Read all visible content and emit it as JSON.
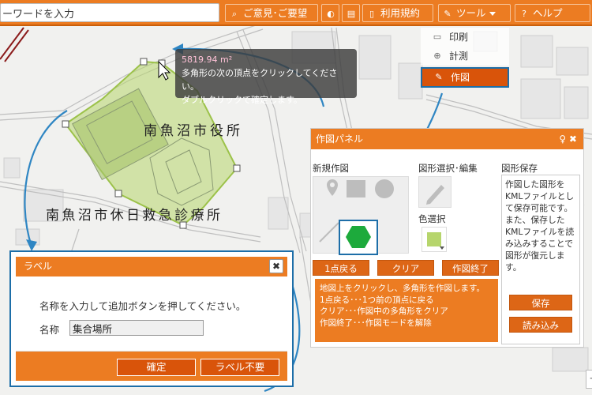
{
  "header": {
    "search_value": "ーワードを入力",
    "search_icon_glyph": "⌕",
    "feedback_label": "ご意見･ご要望",
    "tip_icon_glyph": "◐",
    "chat_icon_glyph": "▤",
    "terms_icon_glyph": "▯",
    "terms_label": "利用規約",
    "tools_icon_glyph": "✎",
    "tools_label": "ツール",
    "help_icon_glyph": "?",
    "help_label": "ヘルプ"
  },
  "tools_menu": {
    "items": [
      {
        "icon": "▭",
        "label": "印刷"
      },
      {
        "icon": "⊕",
        "label": "計測"
      },
      {
        "icon": "✎",
        "label": "作図"
      }
    ]
  },
  "map": {
    "labels": {
      "city_hall": "南魚沼市役所",
      "clinic": "南魚沼市休日救急診療所"
    }
  },
  "measure_tooltip": {
    "area": "5819.94 m²",
    "line1": "多角形の次の頂点をクリックしてください。",
    "line2": "ダブルクリックで確定します。"
  },
  "draw_panel": {
    "title": "作図パネル",
    "head_icons": "♀ ✖",
    "new_drawing_label": "新規作図",
    "select_edit_label": "図形選択･編集",
    "save_shape_label": "図形保存",
    "color_select_label": "色選択",
    "btn_undo": "1点戻る",
    "btn_clear": "クリア",
    "btn_finish": "作図終了",
    "help_text": "地図上をクリックし、多角形を作図します。\n1点戻る･･･1つ前の頂点に戻る\nクリア･･･作図中の多角形をクリア\n作図終了･･･作図モードを解除",
    "save_text": "作図した図形をKMLファイルとして保存可能です。また、保存したKMLファイルを読み込みすることで図形が復元します。",
    "btn_save": "保存",
    "btn_load": "読み込み",
    "colors": {
      "accent": "#ec7c22",
      "shape_fill": "#b6d56c",
      "active_shape": "#1daa3c",
      "highlight_border": "#1d6ea8"
    }
  },
  "label_dialog": {
    "title": "ラベル",
    "close_glyph": "✖",
    "instruction": "名称を入力して追加ボタンを押してください。",
    "name_label": "名称",
    "name_value": "集合場所",
    "btn_confirm": "確定",
    "btn_no_label": "ラベル不要"
  },
  "zoom": {
    "plus_glyph": "+"
  }
}
